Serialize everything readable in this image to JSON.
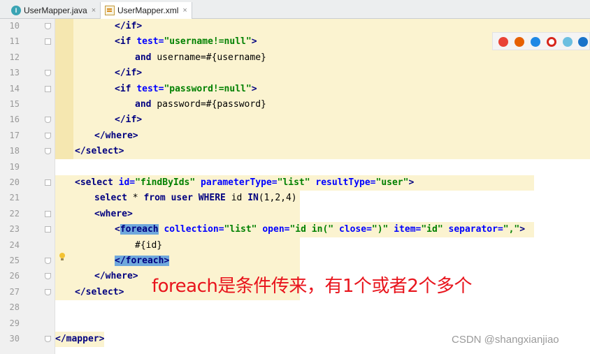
{
  "tabs": [
    {
      "label": "UserMapper.java",
      "icon": "java-class-icon"
    },
    {
      "label": "UserMapper.xml",
      "icon": "xml-file-icon"
    }
  ],
  "tab_close": "×",
  "lines": [
    {
      "n": "10",
      "parts": [
        {
          "t": "</",
          "c": "tag"
        },
        {
          "t": "if",
          "c": "tag"
        },
        {
          "t": ">",
          "c": "tag"
        }
      ]
    },
    {
      "n": "11",
      "parts": [
        {
          "t": "<if ",
          "c": "tag"
        },
        {
          "t": "test=",
          "c": "attr"
        },
        {
          "t": "\"username!=null\"",
          "c": "val"
        },
        {
          "t": ">",
          "c": "tag"
        }
      ]
    },
    {
      "n": "12",
      "parts": [
        {
          "t": "and ",
          "c": "kw"
        },
        {
          "t": "username=#{username}",
          "c": "txt"
        }
      ]
    },
    {
      "n": "13",
      "parts": [
        {
          "t": "</if>",
          "c": "tag"
        }
      ]
    },
    {
      "n": "14",
      "parts": [
        {
          "t": "<if ",
          "c": "tag"
        },
        {
          "t": "test=",
          "c": "attr"
        },
        {
          "t": "\"password!=null\"",
          "c": "val"
        },
        {
          "t": ">",
          "c": "tag"
        }
      ]
    },
    {
      "n": "15",
      "parts": [
        {
          "t": "and ",
          "c": "kw"
        },
        {
          "t": "password=#{password}",
          "c": "txt"
        }
      ]
    },
    {
      "n": "16",
      "parts": [
        {
          "t": "</if>",
          "c": "tag"
        }
      ]
    },
    {
      "n": "17",
      "parts": [
        {
          "t": "</where>",
          "c": "tag"
        }
      ]
    },
    {
      "n": "18",
      "parts": [
        {
          "t": "</select>",
          "c": "tag"
        }
      ]
    },
    {
      "n": "19",
      "parts": []
    },
    {
      "n": "20",
      "parts": [
        {
          "t": "<select ",
          "c": "tag"
        },
        {
          "t": "id=",
          "c": "attr"
        },
        {
          "t": "\"findByIds\" ",
          "c": "val"
        },
        {
          "t": "parameterType=",
          "c": "attr"
        },
        {
          "t": "\"list\" ",
          "c": "val"
        },
        {
          "t": "resultType=",
          "c": "attr"
        },
        {
          "t": "\"user\"",
          "c": "val"
        },
        {
          "t": ">",
          "c": "tag"
        }
      ]
    },
    {
      "n": "21",
      "parts": [
        {
          "t": "select ",
          "c": "kw"
        },
        {
          "t": "* ",
          "c": "txt"
        },
        {
          "t": "from ",
          "c": "kw"
        },
        {
          "t": "user ",
          "c": "kw"
        },
        {
          "t": "WHERE ",
          "c": "kw"
        },
        {
          "t": "id ",
          "c": "txt"
        },
        {
          "t": "IN",
          "c": "kw"
        },
        {
          "t": "(1,2,4)",
          "c": "txt"
        }
      ]
    },
    {
      "n": "22",
      "parts": [
        {
          "t": "<where>",
          "c": "tag"
        }
      ]
    },
    {
      "n": "23",
      "parts": [
        {
          "t": "<",
          "c": "tag"
        },
        {
          "t": "foreach",
          "c": "tag sel"
        },
        {
          "t": " collection=",
          "c": "attr"
        },
        {
          "t": "\"list\" ",
          "c": "val"
        },
        {
          "t": "open=",
          "c": "attr"
        },
        {
          "t": "\"id in(\" ",
          "c": "val"
        },
        {
          "t": "close=",
          "c": "attr"
        },
        {
          "t": "\")\" ",
          "c": "val"
        },
        {
          "t": "item=",
          "c": "attr"
        },
        {
          "t": "\"id\" ",
          "c": "val"
        },
        {
          "t": "separator=",
          "c": "attr"
        },
        {
          "t": "\",\"",
          "c": "val"
        },
        {
          "t": ">",
          "c": "tag"
        }
      ]
    },
    {
      "n": "24",
      "parts": [
        {
          "t": "#{id}",
          "c": "txt"
        }
      ]
    },
    {
      "n": "25",
      "parts": [
        {
          "t": "</",
          "c": "tag sel"
        },
        {
          "t": "foreach",
          "c": "tag sel"
        },
        {
          "t": ">",
          "c": "tag sel"
        }
      ]
    },
    {
      "n": "26",
      "parts": [
        {
          "t": "</where>",
          "c": "tag"
        }
      ]
    },
    {
      "n": "27",
      "parts": [
        {
          "t": "</select>",
          "c": "tag"
        }
      ]
    },
    {
      "n": "28",
      "parts": []
    },
    {
      "n": "29",
      "parts": []
    },
    {
      "n": "30",
      "parts": [
        {
          "t": "</mapper>",
          "c": "tag"
        }
      ]
    }
  ],
  "browsers": [
    {
      "name": "chrome-icon",
      "color": "#e94235"
    },
    {
      "name": "firefox-icon",
      "color": "#e66000"
    },
    {
      "name": "safari-icon",
      "color": "#1e88e5"
    },
    {
      "name": "opera-icon",
      "color": "#d7261b"
    },
    {
      "name": "edge-legacy-icon",
      "color": "#6bbfe0"
    },
    {
      "name": "ie-icon",
      "color": "#1a73c9"
    }
  ],
  "annotation": "foreach是条件传来，有1个或者2个多个",
  "watermark": "CSDN @shangxianjiao"
}
